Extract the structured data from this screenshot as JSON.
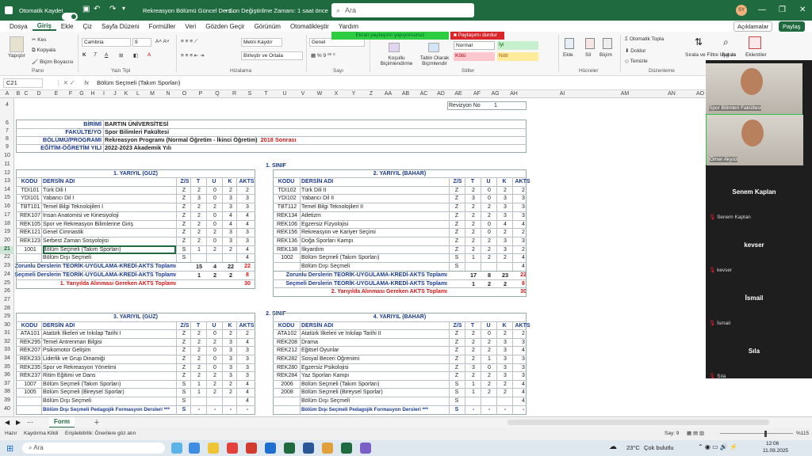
{
  "titlebar": {
    "autosave_label": "Otomatik Kaydet",
    "doc_title": "Rekreasyon Bölümü Güncel Ders...",
    "saved_status": "• Son Değiştirilme Zamanı: 1 saat önce",
    "search_placeholder": "Ara",
    "user_initials": "SY"
  },
  "menu": {
    "items": [
      "Dosya",
      "Giriş",
      "Ekle",
      "Çiz",
      "Sayfa Düzeni",
      "Formüller",
      "Veri",
      "Gözden Geçir",
      "Görünüm",
      "Otomatikleştir",
      "Yardım"
    ],
    "active": "Giriş",
    "comments": "Açıklamalar",
    "share": "Paylaş"
  },
  "sharing": {
    "active": "Ekran paylaşımı yapıyorsunuz",
    "stop": "Paylaşımı durdur"
  },
  "ribbon": {
    "paste": "Yapıştır",
    "cut": "Kes",
    "copy": "Kopyala",
    "format_painter": "Biçim Boyacısı",
    "clipboard_group": "Pano",
    "font_name": "Cambria",
    "font_size": "9",
    "font_group": "Yazı Tipi",
    "wrap_text": "Metni Kaydır",
    "merge_center": "Birleştir ve Ortala",
    "align_group": "Hizalama",
    "number_format": "Genel",
    "number_group": "Sayı",
    "cond_format": "Koşullu Biçimlendirme",
    "format_table": "Tablo Olarak Biçimlendir",
    "styles": {
      "normal": "Normal",
      "good": "İyi",
      "bad": "Kötü",
      "neutral": "Nötr"
    },
    "styles_group": "Stiller",
    "insert": "Ekle",
    "delete": "Sil",
    "format": "Biçim",
    "cells_group": "Hücreler",
    "autosum": "Otomatik Topla",
    "fill": "Doldur",
    "clear": "Temizle",
    "sort_filter": "Sırala ve Filtre Uygula",
    "find_select": "Bul ve",
    "editing_group": "Düzenleme",
    "addins": "Eklentiler"
  },
  "formula": {
    "name_box": "C21",
    "fx": "fx",
    "content": "Bölüm Seçmeli (Takım Sporları)"
  },
  "columns": [
    "A",
    "B",
    "C",
    "D",
    "E",
    "F",
    "G",
    "H",
    "I",
    "J",
    "K",
    "L",
    "M",
    "N",
    "O",
    "P",
    "Q",
    "R",
    "S",
    "T",
    "U",
    "V",
    "W",
    "X",
    "Y",
    "Z",
    "AA",
    "AB",
    "AC",
    "AD",
    "AE",
    "AF",
    "AG",
    "AH",
    "AI",
    "AM",
    "AN",
    "AO"
  ],
  "rows": [
    "4",
    "6",
    "7",
    "8",
    "9",
    "10",
    "11",
    "12",
    "13",
    "14",
    "15",
    "16",
    "17",
    "18",
    "19",
    "20",
    "21",
    "22",
    "23",
    "24",
    "25",
    "26",
    "27",
    "28",
    "29",
    "30",
    "31",
    "32",
    "33",
    "34",
    "35",
    "36",
    "37",
    "38",
    "39",
    "40"
  ],
  "sheet": {
    "revizyon_label": "Revizyon No",
    "revizyon_value": "1",
    "info": [
      {
        "label": "BİRİMİ",
        "value": "BARTIN ÜNİVERSİTESİ"
      },
      {
        "label": "FAKÜLTE/YO",
        "value": "Spor Bilimleri Fakültesi"
      },
      {
        "label": "BÖLÜMÜ/PROGRAMI",
        "value": "Rekreasyon Programı (Normal Öğretim - İkinci Öğretim)",
        "suffix": "2018 Sonrası"
      },
      {
        "label": "EĞİTİM-ÖĞRETİM YILI",
        "value": "2022-2023 Akademik Yılı"
      }
    ],
    "class1": "1. SINIF",
    "class2": "2. SINIF",
    "headers": {
      "code": "KODU",
      "name": "DERSİN ADI",
      "zs": "Z/S",
      "t": "T",
      "u": "U",
      "k": "K",
      "akts": "AKTS"
    },
    "sem1": {
      "title": "1. YARIYIL (GÜZ)",
      "rows": [
        [
          "TDİ101",
          "Türk Dili I",
          "Z",
          "2",
          "0",
          "2",
          "2"
        ],
        [
          "YDİ101",
          "Yabancı Dil I",
          "Z",
          "3",
          "0",
          "3",
          "3"
        ],
        [
          "TBT101",
          "Temel Bilgi Teknolojileri I",
          "Z",
          "2",
          "2",
          "3",
          "3"
        ],
        [
          "REK107",
          "İnsan Anatomisi ve Kinesiyoloji",
          "Z",
          "2",
          "0",
          "4",
          "4"
        ],
        [
          "REK105",
          "Spor ve Rekreasyon Bilimlerine Giriş",
          "Z",
          "2",
          "0",
          "4",
          "4"
        ],
        [
          "REK121",
          "Genel Cimnastik",
          "Z",
          "2",
          "2",
          "3",
          "3"
        ],
        [
          "REK123",
          "Serbest Zaman Sosyolojisi",
          "Z",
          "2",
          "0",
          "3",
          "3"
        ],
        [
          "1001",
          "Bölüm Seçmeli (Takım Sporları)",
          "S",
          "1",
          "2",
          "2",
          "4"
        ],
        [
          "",
          "Bölüm Dışı Seçmeli",
          "S",
          "",
          "",
          "",
          "4"
        ]
      ],
      "sum1_label": "Zorunlu Derslerin TEORİK-UYGULAMA-KREDİ-AKTS Toplamı",
      "sum1": [
        "15",
        "4",
        "22",
        "22"
      ],
      "sum2_label": "Seçmeli Derslerin TEORİK-UYGULAMA-KREDİ-AKTS Toplamı",
      "sum2": [
        "1",
        "2",
        "2",
        "8"
      ],
      "total_label": "1. Yarıyılda Alınması Gereken AKTS Toplamı",
      "total": "30"
    },
    "sem2": {
      "title": "2. YARIYIL  (BAHAR)",
      "rows": [
        [
          "TDİ102",
          "Türk Dili II",
          "Z",
          "2",
          "0",
          "2",
          "2"
        ],
        [
          "YDİ102",
          "Yabancı Dil II",
          "Z",
          "3",
          "0",
          "3",
          "3"
        ],
        [
          "TBT112",
          "Temel Bilgi Teknolojileri II",
          "Z",
          "2",
          "2",
          "3",
          "3"
        ],
        [
          "REK134",
          "Atletizm",
          "Z",
          "2",
          "2",
          "3",
          "3"
        ],
        [
          "REK106",
          "Egzersiz Fizyolojisi",
          "Z",
          "2",
          "0",
          "4",
          "4"
        ],
        [
          "REK156",
          "Rekreasyon ve Kariyer Seçimi",
          "Z",
          "2",
          "0",
          "2",
          "2"
        ],
        [
          "REK136",
          "Doğa Sporları Kampı",
          "Z",
          "2",
          "2",
          "3",
          "3"
        ],
        [
          "REK138",
          "İlkyardım",
          "Z",
          "2",
          "2",
          "3",
          "2"
        ],
        [
          "1002",
          "Bölüm Seçmeli (Takım Sporları)",
          "S",
          "1",
          "2",
          "2",
          "4"
        ],
        [
          "",
          "Bölüm Dışı Seçmeli",
          "S",
          "",
          "",
          "",
          "4"
        ]
      ],
      "sum1_label": "Zorunlu Derslerin TEORİK-UYGULAMA-KREDİ-AKTS Toplamı",
      "sum1": [
        "17",
        "8",
        "23",
        "22"
      ],
      "sum2_label": "Seçmeli Derslerin TEORİK-UYGULAMA-KREDİ-AKTS Toplamı",
      "sum2": [
        "1",
        "2",
        "2",
        "8"
      ],
      "total_label": "2. Yarıyılda Alınması Gereken AKTS Toplamı",
      "total": "30"
    },
    "sem3": {
      "title": "3. YARIYIL (GÜZ)",
      "rows": [
        [
          "ATA101",
          "Atatürk İlkeleri ve İnkılap Tarihi I",
          "Z",
          "2",
          "0",
          "2",
          "2"
        ],
        [
          "REK295",
          "Temel Antrenman Bilgisi",
          "Z",
          "2",
          "2",
          "3",
          "4"
        ],
        [
          "REK207",
          "Psikomotor Gelişim",
          "Z",
          "2",
          "0",
          "3",
          "3"
        ],
        [
          "REK233",
          "Liderlik ve Grup Dinamiği",
          "Z",
          "2",
          "0",
          "3",
          "3"
        ],
        [
          "REK235",
          "Spor ve Rekreasyon Yönetimi",
          "Z",
          "2",
          "0",
          "3",
          "3"
        ],
        [
          "REK237",
          "Ritim Eğitimi ve Dans",
          "Z",
          "2",
          "2",
          "3",
          "3"
        ],
        [
          "1007",
          "Bölüm Seçmeli (Takım Sporları)",
          "S",
          "1",
          "2",
          "2",
          "4"
        ],
        [
          "1005",
          "Bölüm Seçmeli (Bireysel Sporlar)",
          "S",
          "1",
          "2",
          "2",
          "4"
        ],
        [
          "",
          "Bölüm Dışı Seçmeli",
          "S",
          "",
          "",
          "",
          "4"
        ],
        [
          "",
          "Bölüm Dışı Seçmeli Pedagojik Formasyon Dersleri ***",
          "S",
          "-",
          "-",
          "-",
          "-"
        ]
      ]
    },
    "sem4": {
      "title": "4. YARIYIL  (BAHAR)",
      "rows": [
        [
          "ATA102",
          "Atatürk İlkeleri ve İnkılap Tarihi II",
          "Z",
          "2",
          "0",
          "2",
          "2"
        ],
        [
          "REK208",
          "Drama",
          "Z",
          "2",
          "2",
          "3",
          "3"
        ],
        [
          "REK212",
          "Eğitsel Oyunlar",
          "Z",
          "2",
          "2",
          "3",
          "4"
        ],
        [
          "REK282",
          "Sosyal Beceri Öğrenimi",
          "Z",
          "2",
          "1",
          "3",
          "3"
        ],
        [
          "REK280",
          "Egzersiz Psikolojisi",
          "Z",
          "3",
          "0",
          "3",
          "3"
        ],
        [
          "REK284",
          "Yaz Sporları Kampı",
          "Z",
          "2",
          "2",
          "3",
          "3"
        ],
        [
          "2006",
          "Bölüm Seçmeli (Takım Sporları)",
          "S",
          "1",
          "2",
          "2",
          "4"
        ],
        [
          "2008",
          "Bölüm Seçmeli (Bireysel Sporlar)",
          "S",
          "1",
          "2",
          "2",
          "4"
        ],
        [
          "",
          "Bölüm Dışı Seçmeli",
          "S",
          "",
          "",
          "",
          "4"
        ],
        [
          "",
          "Bölüm Dışı Seçmeli Pedagojik Formasyon Dersleri ***",
          "S",
          "-",
          "-",
          "-",
          "-"
        ]
      ]
    }
  },
  "sheetbar": {
    "tab": "Form"
  },
  "status": {
    "ready": "Hazır",
    "recovered": "Kaydırma Kilidi",
    "accessibility": "Erişilebilirlik: Önerilere göz atın",
    "count": "Say: 9",
    "zoom": "%115"
  },
  "taskbar": {
    "search": "Ara",
    "weather_temp": "23°C",
    "weather_desc": "Çok bulutlu",
    "time": "12:06",
    "date": "11.09.2025"
  },
  "meeting": {
    "participants": [
      {
        "name": "Spor Bilimleri Fakültesi",
        "video": true
      },
      {
        "name": "Ömer Akyüz",
        "video": true
      },
      {
        "name": "Senem Kaplan",
        "tag": "Senem Kaplan",
        "video": false
      },
      {
        "name": "kevser",
        "tag": "kevser",
        "video": false
      },
      {
        "name": "İsmail",
        "tag": "İsmail",
        "video": false
      },
      {
        "name": "Sıla",
        "tag": "Sıla",
        "video": false
      }
    ]
  }
}
